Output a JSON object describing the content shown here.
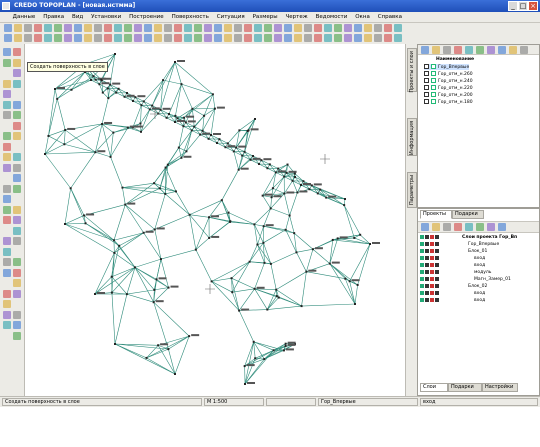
{
  "window": {
    "title": "CREDO TOPOPLAN - [новая.нстмма]",
    "buttons": [
      "minimize",
      "maximize",
      "close"
    ]
  },
  "menu": [
    "Данные",
    "Правка",
    "Вид",
    "Установки",
    "Построение",
    "Поверхность",
    "Ситуация",
    "Размеры",
    "Чертеж",
    "Ведомости",
    "Окна",
    "Справка"
  ],
  "tooltip": "Создать поверхность в слое",
  "vertical_tabs": [
    "Проекты и слои",
    "Информация",
    "Параметры"
  ],
  "layers_panel": {
    "header": "Наименование",
    "items": [
      "Гор_Впервые",
      "Гор_отм_н.260",
      "Гор_отм_н.240",
      "Гор_отм_н.220",
      "Гор_отм_н.200",
      "Гор_отм_н.180"
    ]
  },
  "bottom_panel": {
    "tabs": [
      "Проекты",
      "Подарки"
    ],
    "tree": [
      "Слои проекта Гор_Вп",
      "Гор_Впервые",
      "Блок_01",
      "вход",
      "вход",
      "модуль",
      "Магн_Замер_01",
      "Блок_02",
      "вход",
      "вход"
    ],
    "bottom_tabs": [
      "Слои",
      "Подарки",
      "Настройки"
    ]
  },
  "status": {
    "hint": "Создать поверхность в слое",
    "scale": "М 1:500",
    "layer": "Гор_Впервые",
    "extra": "вход"
  },
  "colors": {
    "tin_lines": "#2e8b7a",
    "highlight": "#1e90ff",
    "titlebar": "#2a5fc8"
  }
}
